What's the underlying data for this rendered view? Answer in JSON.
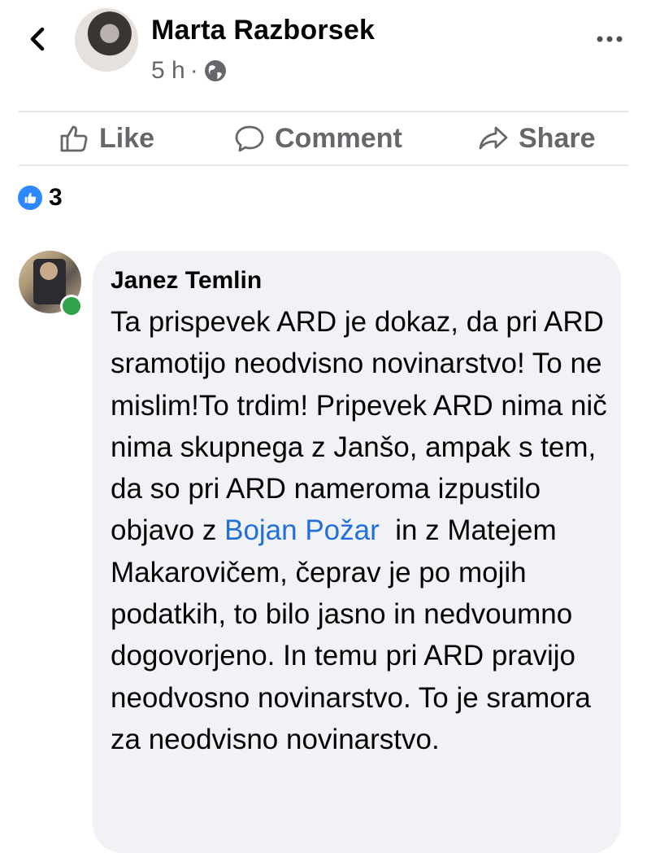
{
  "post": {
    "author": "Marta Razborsek",
    "time": "5 h",
    "separator": "·",
    "privacy_icon": "globe-icon"
  },
  "actions": {
    "like": "Like",
    "comment": "Comment",
    "share": "Share"
  },
  "reactions": {
    "icon": "like-reaction-icon",
    "count": "3"
  },
  "comment": {
    "author": "Janez Temlin",
    "text_part1": "Ta prispevek ARD je dokaz, da pri ARD sramotijo neodvisno novinarstvo! To ne mislim!To trdim! Pripevek ARD nima nič nima skupnega z Janšo, ampak s tem, da so pri ARD nameroma izpustilo objavo z ",
    "mention": "Bojan Požar",
    "text_part2": "  in z Matejem Makarovičem, čeprav je po mojih podatkih, to bilo jasno in nedvoumno dogovorjeno. In temu pri ARD pravijo neodvosno novinarstvo. To je sramora za neodvisno novinarstvo.",
    "online": true
  },
  "colors": {
    "mention": "#216fdb",
    "muted": "#65676b",
    "bubble": "#f0f2f5",
    "online": "#31a24c",
    "like_blue": "#2d88ff"
  }
}
